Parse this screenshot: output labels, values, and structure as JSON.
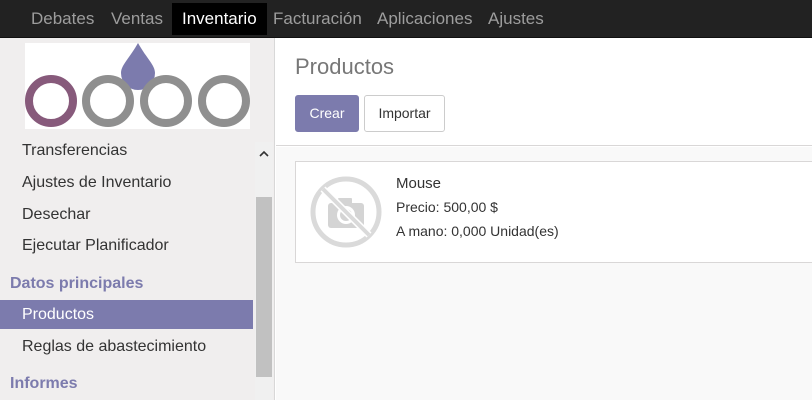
{
  "topbar": {
    "items": [
      {
        "label": "Debates",
        "active": false
      },
      {
        "label": "Ventas",
        "active": false
      },
      {
        "label": "Inventario",
        "active": true
      },
      {
        "label": "Facturación",
        "active": false
      },
      {
        "label": "Aplicaciones",
        "active": false
      },
      {
        "label": "Ajustes",
        "active": false
      }
    ]
  },
  "sidebar": {
    "logo_icon": "odoo-logo",
    "items": [
      {
        "label": "Transferencias"
      },
      {
        "label": "Ajustes de Inventario"
      },
      {
        "label": "Desechar"
      },
      {
        "label": "Ejecutar Planificador"
      }
    ],
    "sections": [
      {
        "title": "Datos principales",
        "items": [
          {
            "label": "Productos",
            "active": true
          },
          {
            "label": "Reglas de abastecimiento",
            "active": false
          }
        ]
      },
      {
        "title": "Informes",
        "items": []
      }
    ]
  },
  "main": {
    "title": "Productos",
    "create_label": "Crear",
    "import_label": "Importar"
  },
  "products": [
    {
      "name": "Mouse",
      "price": "Precio: 500,00 $",
      "on_hand": "A mano: 0,000 Unidad(es)",
      "image_icon": "no-photo-camera-icon"
    }
  ],
  "colors": {
    "accent": "#7c7bad",
    "topbar": "#222222",
    "logo_purple": "#875a7b",
    "logo_grey": "#8f8f8f"
  }
}
